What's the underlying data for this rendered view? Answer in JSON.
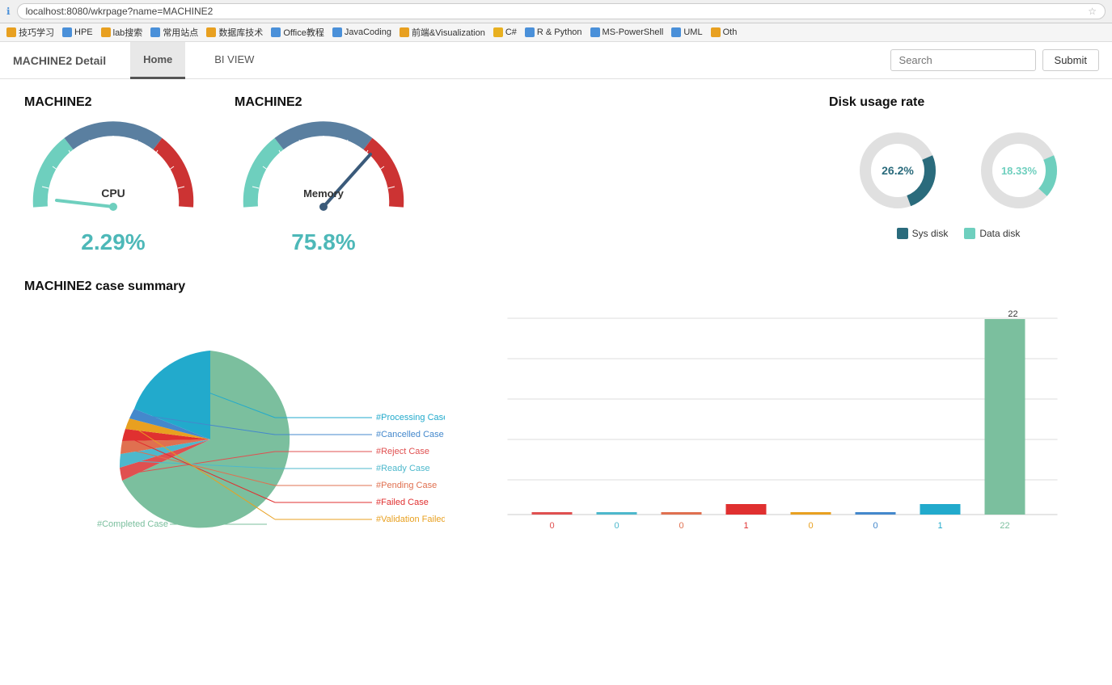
{
  "browser": {
    "url": "localhost:8080/wkrpage?name=MACHINE2",
    "bookmarks": [
      {
        "label": "技巧学习",
        "color": "#e8a020"
      },
      {
        "label": "HPE",
        "color": "#4a90d9"
      },
      {
        "label": "lab搜索",
        "color": "#e8a020"
      },
      {
        "label": "常用站点",
        "color": "#4a90d9"
      },
      {
        "label": "数据库技术",
        "color": "#e8a020"
      },
      {
        "label": "Office教程",
        "color": "#4a90d9"
      },
      {
        "label": "JavaCoding",
        "color": "#4a90d9"
      },
      {
        "label": "前端&Visualization",
        "color": "#e8a020"
      },
      {
        "label": "C#",
        "color": "#e8b020"
      },
      {
        "label": "R & Python",
        "color": "#4a90d9"
      },
      {
        "label": "MS-PowerShell",
        "color": "#4a90d9"
      },
      {
        "label": "UML",
        "color": "#4a90d9"
      },
      {
        "label": "Oth",
        "color": "#e8a020"
      }
    ]
  },
  "header": {
    "title": "MACHINE2 Detail",
    "tabs": [
      {
        "label": "Home",
        "active": true
      },
      {
        "label": "BI VIEW",
        "active": false
      }
    ],
    "search_placeholder": "Search",
    "submit_label": "Submit"
  },
  "cpu_gauge": {
    "machine_label": "MACHINE2",
    "center_label": "CPU",
    "value": "2.29%",
    "percent": 2.29
  },
  "memory_gauge": {
    "machine_label": "MACHINE2",
    "center_label": "Memory",
    "value": "75.8%",
    "percent": 75.8
  },
  "disk": {
    "title": "Disk usage rate",
    "sys_disk": {
      "label": "Sys disk",
      "value": "26.2%",
      "percent": 26.2,
      "color": "#2a6b7c"
    },
    "data_disk": {
      "label": "Data disk",
      "value": "18.33%",
      "percent": 18.33,
      "color": "#6ecfbe"
    }
  },
  "case_summary": {
    "title": "MACHINE2 case summary",
    "pie_segments": [
      {
        "label": "#Reject Case",
        "color": "#e05050",
        "value": 0,
        "percent": 0.5
      },
      {
        "label": "#Ready Case",
        "color": "#4db8cc",
        "value": 0,
        "percent": 0.5
      },
      {
        "label": "#Pending Case",
        "color": "#e07050",
        "value": 0,
        "percent": 0.5
      },
      {
        "label": "#Failed Case",
        "color": "#e03030",
        "value": 1,
        "percent": 1.5
      },
      {
        "label": "#Validation Failed Case",
        "color": "#e8a020",
        "value": 0,
        "percent": 0.5
      },
      {
        "label": "#Cancelled Case",
        "color": "#4488cc",
        "value": 0,
        "percent": 0.5
      },
      {
        "label": "#Processing Case",
        "color": "#22aacc",
        "value": 1,
        "percent": 1.5
      },
      {
        "label": "#Completed Case",
        "color": "#7bbf9e",
        "value": 22,
        "percent": 94.5
      }
    ],
    "bar_max": 22,
    "x_labels": [
      "0",
      "0",
      "0",
      "1",
      "0",
      "0",
      "1",
      "22"
    ]
  }
}
